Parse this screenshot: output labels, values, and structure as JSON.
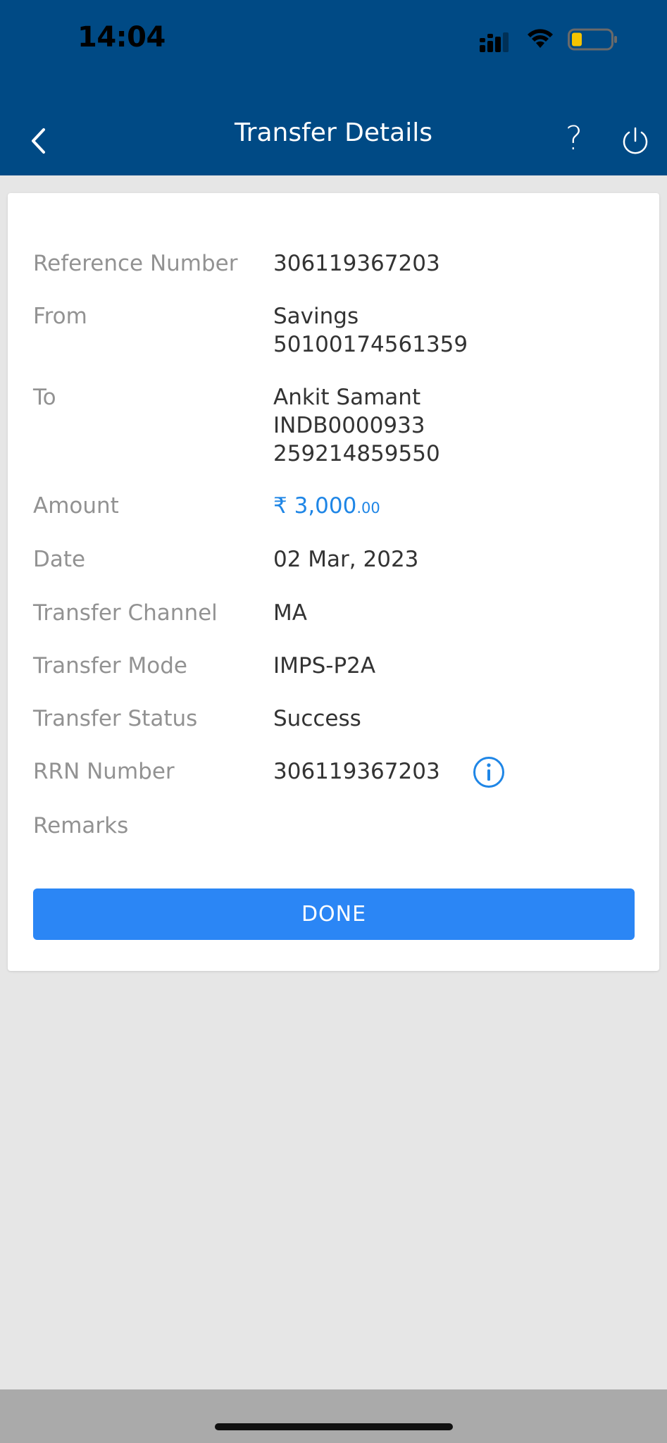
{
  "status_bar": {
    "time": "14:04"
  },
  "header": {
    "title": "Transfer Details",
    "help_label": "?"
  },
  "details": {
    "reference_number": {
      "label": "Reference Number",
      "value": "306119367203"
    },
    "from": {
      "label": "From",
      "account_type": "Savings",
      "account_number": "50100174561359"
    },
    "to": {
      "label": "To",
      "name": "Ankit Samant",
      "ifsc": "INDB0000933",
      "account_number": "259214859550"
    },
    "amount": {
      "label": "Amount",
      "currency": "₹",
      "rupees": "3,000",
      "paise": ".00"
    },
    "date": {
      "label": "Date",
      "value": "02 Mar, 2023"
    },
    "transfer_channel": {
      "label": "Transfer Channel",
      "value": "MA"
    },
    "transfer_mode": {
      "label": "Transfer Mode",
      "value": "IMPS-P2A"
    },
    "transfer_status": {
      "label": "Transfer Status",
      "value": "Success"
    },
    "rrn_number": {
      "label": "RRN Number",
      "value": "306119367203"
    },
    "remarks": {
      "label": "Remarks",
      "value": ""
    }
  },
  "actions": {
    "done_label": "DONE"
  },
  "colors": {
    "header_bg": "#004a85",
    "accent_blue": "#2b86f5",
    "amount_blue": "#1f86e6",
    "battery_yellow": "#f5c400"
  }
}
